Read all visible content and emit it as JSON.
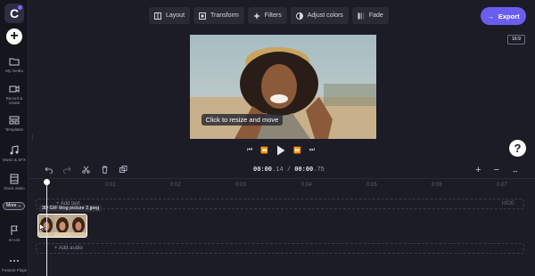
{
  "sidebar": {
    "logo": "C",
    "add_label": "+",
    "items": [
      {
        "label": "My media",
        "icon": "folder-icon"
      },
      {
        "label": "Record & create",
        "icon": "camera-icon"
      },
      {
        "label": "Templates",
        "icon": "templates-icon"
      },
      {
        "label": "Music & SFX",
        "icon": "music-icon"
      },
      {
        "label": "Stock video",
        "icon": "film-icon"
      },
      {
        "label": "en-US",
        "icon": "flag-icon"
      },
      {
        "label": "Feature Flags",
        "icon": "dots-icon"
      }
    ],
    "more_label": "More"
  },
  "toolbar": {
    "layout": "Layout",
    "transform": "Transform",
    "filters": "Filters",
    "adjust_colors": "Adjust colors",
    "fade": "Fade"
  },
  "export": {
    "label": "Export"
  },
  "aspect_ratio": "16:9",
  "preview": {
    "tooltip": "Click to resize and move"
  },
  "playback": {
    "current_time": "00:00",
    "current_frac": ".14",
    "separator": "/",
    "total_time": "00:00",
    "total_frac": ".75"
  },
  "timeline": {
    "ticks": [
      "0:01",
      "0:02",
      "0:03",
      "0:04",
      "0:05",
      "0:06",
      "0:07"
    ],
    "add_text": "+ Add text",
    "add_audio": "+ Add audio",
    "hide": "HIDE",
    "clip_name": "3D GIF blog picture 2.jpeg"
  },
  "help_label": "?",
  "colors": {
    "accent": "#6a5ef0",
    "background": "#1c1c26",
    "sidebar": "#15151d"
  }
}
